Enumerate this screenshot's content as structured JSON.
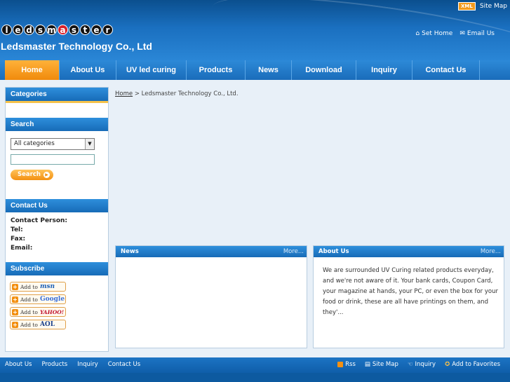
{
  "topbar": {
    "xml_badge": "XML",
    "site_map": "Site Map"
  },
  "header": {
    "logo_letters": [
      "l",
      "e",
      "d",
      "s",
      "m",
      "a",
      "s",
      "t",
      "e",
      "r"
    ],
    "company_name": "Ledsmaster Technology Co., Ltd",
    "set_home": "Set Home",
    "email_us": "Email Us"
  },
  "nav": {
    "items": [
      {
        "label": "Home",
        "active": true
      },
      {
        "label": "About Us"
      },
      {
        "label": "UV led curing"
      },
      {
        "label": "Products"
      },
      {
        "label": "News"
      },
      {
        "label": "Download"
      },
      {
        "label": "Inquiry"
      },
      {
        "label": "Contact Us"
      }
    ]
  },
  "sidebar": {
    "categories_title": "Categories",
    "search_title": "Search",
    "search_select_value": "All categories",
    "search_button": "Search",
    "contact_title": "Contact Us",
    "contact_fields": [
      "Contact Person:",
      "Tel:",
      "Fax:",
      "Email:"
    ],
    "subscribe_title": "Subscribe",
    "subscribe_items": [
      {
        "prefix": "Add to",
        "brand": "msn"
      },
      {
        "prefix": "Add to",
        "brand": "Google"
      },
      {
        "prefix": "Add to",
        "brand": "YAHOO!"
      },
      {
        "prefix": "Add to",
        "brand": "AOL"
      }
    ]
  },
  "breadcrumb": {
    "home": "Home",
    "separator": ">",
    "current": "Ledsmaster Technology Co., Ltd."
  },
  "news_panel": {
    "title": "News",
    "more": "More..."
  },
  "about_panel": {
    "title": "About Us",
    "more": "More...",
    "text": "We are surrounded UV Curing related products everyday, and we're not aware of it. Your bank cards, Coupon Card, your magazine at hands, your PC, or even the box for your food or drink, these are all have printings on them, and they'..."
  },
  "footer": {
    "left_links": [
      "About Us",
      "Products",
      "Inquiry",
      "Contact Us"
    ],
    "rss": "Rss",
    "site_map": "Site Map",
    "inquiry": "Inquiry",
    "favorites": "Add to Favorites"
  },
  "colors": {
    "primary_blue": "#1a6cba",
    "accent_orange": "#f08a0c",
    "logo_red": "#d8202a"
  }
}
